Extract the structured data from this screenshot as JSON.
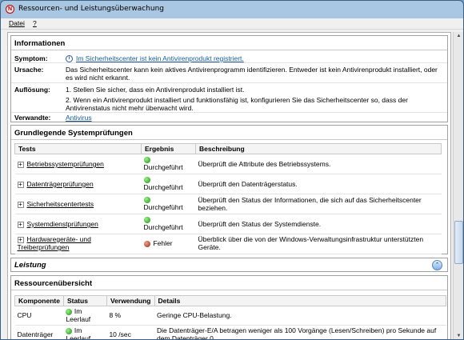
{
  "window": {
    "title": "Ressourcen- und Leistungsüberwachung",
    "app_icon": "N"
  },
  "menu": {
    "file": "Datei",
    "help": "?"
  },
  "info": {
    "heading": "Informationen",
    "rows": [
      {
        "label": "Symptom:",
        "value": "Im Sicherheitscenter ist kein Antivirenprodukt registriert."
      },
      {
        "label": "Ursache:",
        "value": "Das Sicherheitscenter kann kein aktives Antivirenprogramm identifizieren. Entweder ist kein Antivirenprodukt installiert, oder es wird nicht erkannt."
      },
      {
        "label": "Auflösung:",
        "value": "1. Stellen Sie sicher, dass ein Antivirenprodukt installiert ist."
      },
      {
        "label": "",
        "value": "2. Wenn ein Antivirenprodukt installiert und funktionsfähig ist, konfigurieren Sie das Sicherheitscenter so, dass der Antivirenstatus nicht mehr überwacht wird."
      },
      {
        "label": "Verwandte:",
        "value": "Antivirus"
      }
    ]
  },
  "checks": {
    "heading": "Grundlegende Systemprüfungen",
    "columns": [
      "Tests",
      "Ergebnis",
      "Beschreibung"
    ],
    "rows": [
      {
        "test": "Betriebssystemprüfungen",
        "result": "Durchgeführt",
        "status": "ok",
        "desc": "Überprüft die Attribute des Betriebssystems."
      },
      {
        "test": "Datenträgerprüfungen",
        "result": "Durchgeführt",
        "status": "ok",
        "desc": "Überprüft den Datenträgerstatus."
      },
      {
        "test": "Sicherheitscentertests",
        "result": "Durchgeführt",
        "status": "ok",
        "desc": "Überprüft den Status der Informationen, die sich auf das Sicherheitscenter beziehen."
      },
      {
        "test": "Systemdienstprüfungen",
        "result": "Durchgeführt",
        "status": "ok",
        "desc": "Überprüft den Status der Systemdienste."
      },
      {
        "test": "Hardwaregeräte- und Treiberprüfungen",
        "result": "Fehler",
        "status": "error",
        "desc": "Überblick über die von der Windows-Verwaltungsinfrastruktur unterstützten Geräte."
      }
    ]
  },
  "performance": {
    "heading": "Leistung"
  },
  "resources": {
    "heading": "Ressourcenübersicht",
    "columns": [
      "Komponente",
      "Status",
      "Verwendung",
      "Details"
    ],
    "rows": [
      {
        "component": "CPU",
        "status": "Im Leerlauf",
        "usage": "8 %",
        "details": "Geringe CPU-Belastung."
      },
      {
        "component": "Datenträger",
        "status": "Im Leerlauf",
        "usage": "10 /sec",
        "details": "Die Datenträger-E/A betragen weniger als 100 Vorgänge (Lesen/Schreiben) pro Sekunde auf dem Datenträger 0."
      }
    ]
  }
}
